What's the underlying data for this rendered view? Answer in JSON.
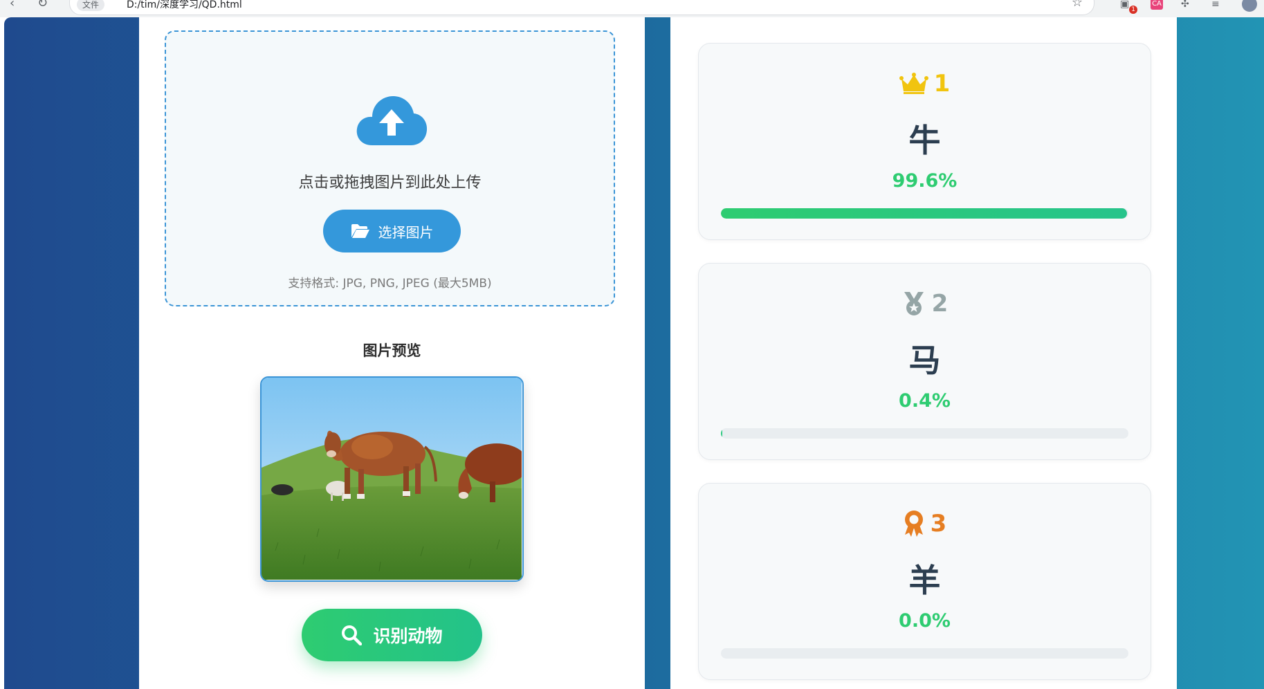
{
  "browser": {
    "secure_label": "文件",
    "url": "D:/tim/深度学习/QD.html",
    "ext_badge": "1",
    "ext_red_label": "CA"
  },
  "upload": {
    "hint": "点击或拖拽图片到此处上传",
    "select_button": "选择图片",
    "formats": "支持格式: JPG, PNG, JPEG (最大5MB)"
  },
  "preview": {
    "title": "图片预览"
  },
  "actions": {
    "identify_button": "识别动物"
  },
  "results": [
    {
      "rank": "1",
      "icon": "crown-icon",
      "color": "#f1c40f",
      "name": "牛",
      "probability": "99.6%",
      "fraction": 0.996
    },
    {
      "rank": "2",
      "icon": "silver-medal-icon",
      "color": "#95a5a6",
      "name": "马",
      "probability": "0.4%",
      "fraction": 0.004
    },
    {
      "rank": "3",
      "icon": "award-icon",
      "color": "#e67e22",
      "name": "羊",
      "probability": "0.0%",
      "fraction": 0.0
    }
  ],
  "colors": {
    "accent_blue": "#3498db",
    "accent_green": "#2ecc71",
    "text_dark": "#2c3e50"
  }
}
